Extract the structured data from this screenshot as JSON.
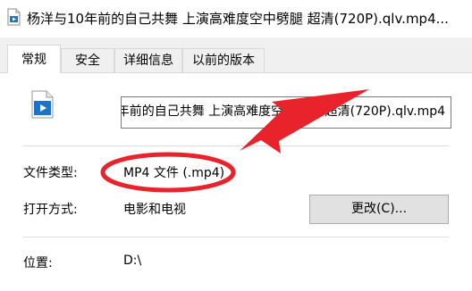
{
  "window": {
    "title": "杨洋与10年前的自己共舞 上演高难度空中劈腿 超清(720P).qlv.mp4...",
    "title_icon": "video-file-icon"
  },
  "tabs": [
    {
      "label": "常规",
      "active": true
    },
    {
      "label": "安全",
      "active": false
    },
    {
      "label": "详细信息",
      "active": false
    },
    {
      "label": "以前的版本",
      "active": false
    }
  ],
  "general": {
    "file_icon": "video-file-icon",
    "file_name": "杨洋与10年前的自己共舞 上演高难度空中劈腿 超清(720P).qlv.mp4",
    "file_type_label": "文件类型:",
    "file_type_value": "MP4 文件 (.mp4)",
    "opens_with_label": "打开方式:",
    "opens_with_value": "电影和电视",
    "change_button_label": "更改(C)...",
    "location_label": "位置:",
    "location_value": "D:\\"
  },
  "annotation": {
    "color": "#e8232b",
    "shapes": [
      "arrow",
      "ellipse"
    ]
  }
}
